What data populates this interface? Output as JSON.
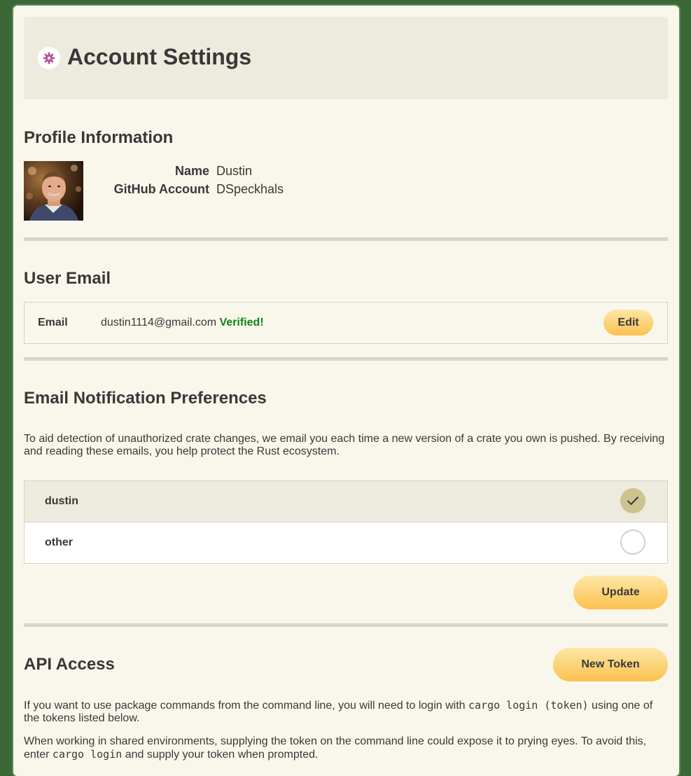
{
  "header": {
    "title": "Account Settings",
    "icon": "gear-icon"
  },
  "profile": {
    "heading": "Profile Information",
    "name_label": "Name",
    "name_value": "Dustin",
    "github_label": "GitHub Account",
    "github_value": "DSpeckhals"
  },
  "user_email": {
    "heading": "User Email",
    "label": "Email",
    "address": "dustin1114@gmail.com",
    "status": "Verified!",
    "edit_label": "Edit"
  },
  "notifications": {
    "heading": "Email Notification Preferences",
    "description": "To aid detection of unauthorized crate changes, we email you each time a new version of a crate you own is pushed. By receiving and reading these emails, you help protect the Rust ecosystem.",
    "items": [
      {
        "name": "dustin",
        "checked": true
      },
      {
        "name": "other",
        "checked": false
      }
    ],
    "update_label": "Update"
  },
  "api": {
    "heading": "API Access",
    "new_token_label": "New Token",
    "para1_before": "If you want to use package commands from the command line, you will need to login with ",
    "para1_code": "cargo login (token)",
    "para1_after": " using one of the tokens listed below.",
    "para2_before": "When working in shared environments, supplying the token on the command line could expose it to prying eyes. To avoid this, enter ",
    "para2_code": "cargo login",
    "para2_after": " and supply your token when prompted."
  },
  "colors": {
    "background": "#3b6837",
    "panel": "#f9f7ec",
    "header_bg": "#edebdd",
    "verified": "#108310",
    "button": "#fbc14f",
    "gear": "#b5549a"
  }
}
